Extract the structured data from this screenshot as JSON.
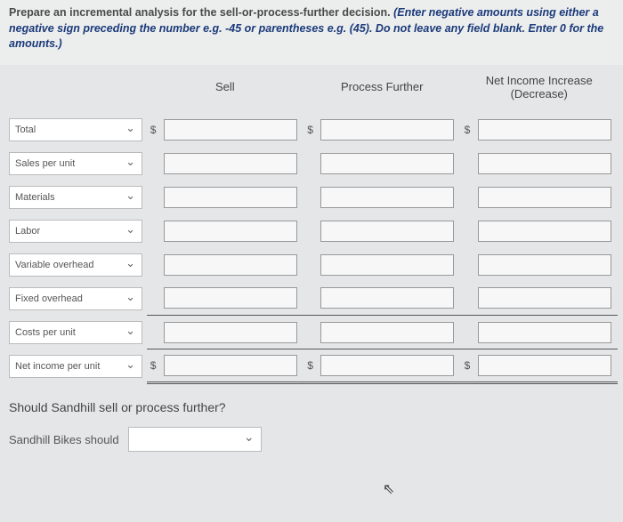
{
  "instructions": {
    "part1": "Prepare an incremental analysis for the sell-or-process-further decision. ",
    "part2": "(Enter negative amounts using either a negative sign preceding the number e.g. -45 or parentheses e.g. (45). Do not leave any field blank. Enter 0 for the amounts.)"
  },
  "headers": {
    "col1": "Sell",
    "col2": "Process Further",
    "col3": "Net Income Increase (Decrease)"
  },
  "rows": [
    {
      "label": "Total",
      "dollar": true
    },
    {
      "label": "Sales per unit",
      "dollar": false
    },
    {
      "label": "Materials",
      "dollar": false
    },
    {
      "label": "Labor",
      "dollar": false
    },
    {
      "label": "Variable overhead",
      "dollar": false
    },
    {
      "label": "Fixed overhead",
      "dollar": false
    },
    {
      "label": "Costs per unit",
      "dollar": false
    },
    {
      "label": "Net income per unit",
      "dollar": true
    }
  ],
  "currency": "$",
  "question": "Should Sandhill sell or process further?",
  "decision": {
    "label": "Sandhill Bikes should",
    "value": ""
  }
}
